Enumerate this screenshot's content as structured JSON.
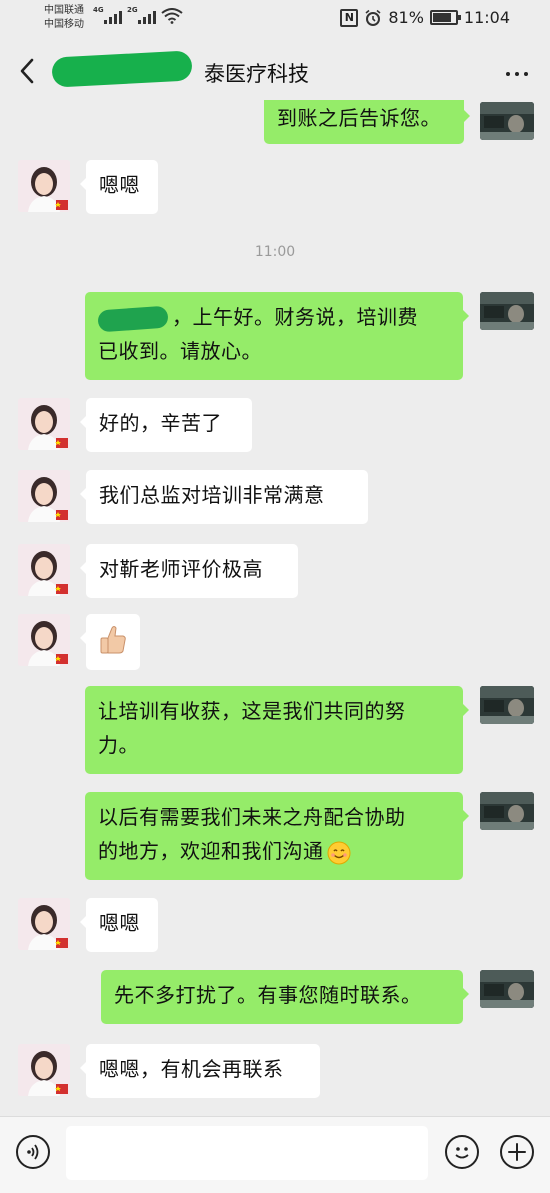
{
  "status_bar": {
    "carrier1": "中国联通",
    "carrier2": "中国移动",
    "net1": "4G",
    "net2": "2G",
    "nfc": "N",
    "battery": "81%",
    "time": "11:04"
  },
  "header": {
    "title_visible": "泰医疗科技",
    "back_icon": "chevron-left-icon",
    "more_icon": "ellipsis-icon"
  },
  "messages": [
    {
      "side": "right",
      "text": "到账之后告诉您。"
    },
    {
      "side": "left",
      "text": "嗯嗯"
    },
    {
      "type": "time",
      "text": "11:00"
    },
    {
      "side": "right",
      "text": "，上午好。财务说，培训费",
      "text2": "已收到。请放心。"
    },
    {
      "side": "left",
      "text": "好的，辛苦了"
    },
    {
      "side": "left",
      "text": "我们总监对培训非常满意"
    },
    {
      "side": "left",
      "text": "对靳老师评价极高"
    },
    {
      "side": "left",
      "icon": "thumbs-up-icon"
    },
    {
      "side": "right",
      "text": "让培训有收获，这是我们共同的努",
      "text2": "力。"
    },
    {
      "side": "right",
      "text": "以后有需要我们未来之舟配合协助",
      "text2": "的地方，欢迎和我们沟通",
      "icon": "smile-emoji-icon"
    },
    {
      "side": "left",
      "text": "嗯嗯"
    },
    {
      "side": "right",
      "text": "先不多打扰了。有事您随时联系。"
    },
    {
      "side": "left",
      "text": "嗯嗯，有机会再联系"
    }
  ],
  "input_bar": {
    "voice_icon": "voice-icon",
    "emoji_icon": "emoji-icon",
    "plus_icon": "plus-icon",
    "placeholder": ""
  },
  "colors": {
    "background": "#ededed",
    "bubble_right": "#95ec69",
    "bubble_left": "#ffffff",
    "redaction": "#1fa34e"
  }
}
